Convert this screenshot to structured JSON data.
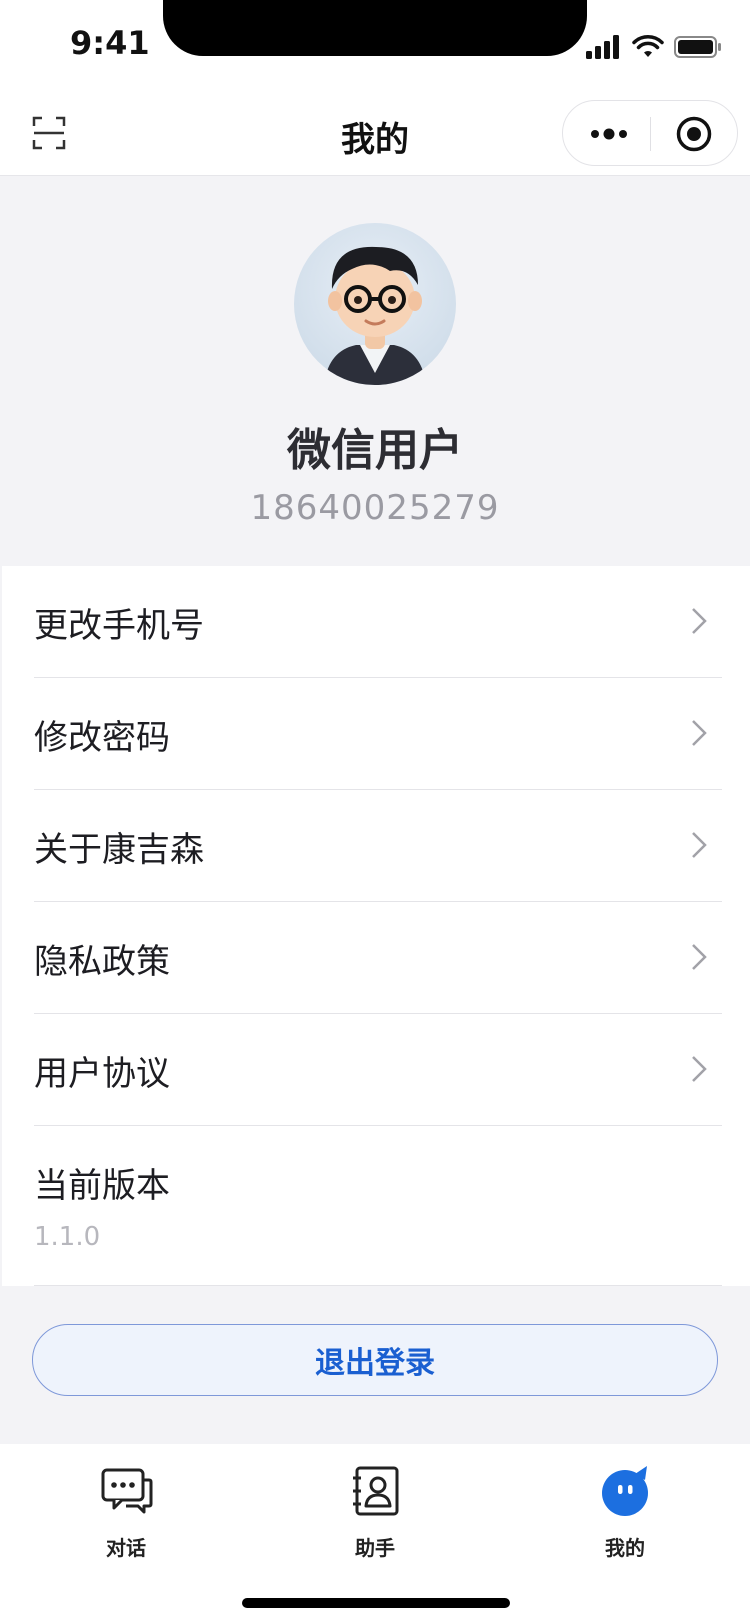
{
  "status_bar": {
    "time": "9:41"
  },
  "nav": {
    "title": "我的"
  },
  "profile": {
    "name": "微信用户",
    "phone": "18640025279"
  },
  "menu": {
    "items": [
      {
        "label": "更改手机号"
      },
      {
        "label": "修改密码"
      },
      {
        "label": "关于康吉森"
      },
      {
        "label": "隐私政策"
      },
      {
        "label": "用户协议"
      }
    ],
    "version": {
      "label": "当前版本",
      "value": "1.1.0"
    }
  },
  "logout": {
    "label": "退出登录"
  },
  "tabs": [
    {
      "label": "对话",
      "icon": "chat-bubble-icon"
    },
    {
      "label": "助手",
      "icon": "contact-book-icon"
    },
    {
      "label": "我的",
      "icon": "profile-bot-icon",
      "active": true
    }
  ],
  "colors": {
    "accent": "#1a5fd1",
    "active_tab": "#1c6fe0",
    "background": "#f3f3f6"
  }
}
